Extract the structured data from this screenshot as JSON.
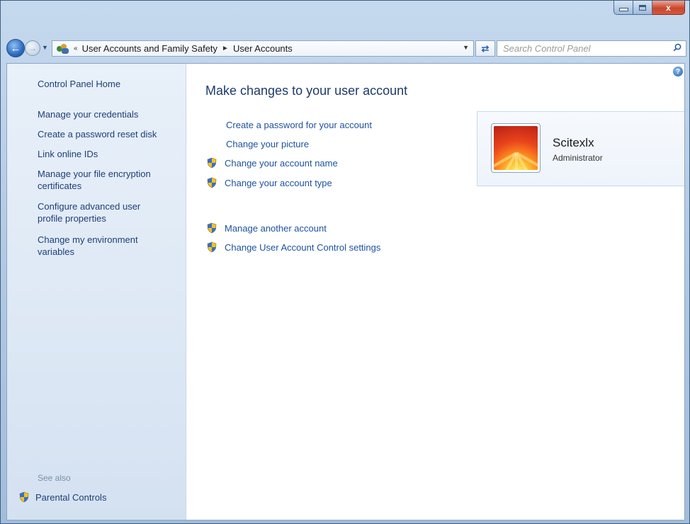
{
  "window": {
    "minimize_label": "minimize",
    "maximize_label": "maximize",
    "close_label": "x"
  },
  "nav": {
    "breadcrumb": {
      "overflow": "«",
      "items": [
        "User Accounts and Family Safety",
        "User Accounts"
      ],
      "separator": "►"
    },
    "search_placeholder": "Search Control Panel"
  },
  "left_pane": {
    "home": "Control Panel Home",
    "links": [
      "Manage your credentials",
      "Create a password reset disk",
      "Link online IDs",
      "Manage your file encryption certificates",
      "Configure advanced user profile properties",
      "Change my environment variables"
    ],
    "see_also_label": "See also",
    "see_also_links": [
      "Parental Controls"
    ]
  },
  "main": {
    "title": "Make changes to your user account",
    "tasks": [
      {
        "label": "Create a password for your account",
        "icon": "none"
      },
      {
        "label": "Change your picture",
        "icon": "none"
      },
      {
        "label": "Change your account name",
        "icon": "uac-shield-icon"
      },
      {
        "label": "Change your account type",
        "icon": "uac-shield-icon"
      }
    ],
    "tasks2": [
      {
        "label": "Manage another account",
        "icon": "uac-shield-icon"
      },
      {
        "label": "Change User Account Control settings",
        "icon": "uac-shield-icon"
      }
    ]
  },
  "account": {
    "name": "Scitexlx",
    "type": "Administrator",
    "picture": "flower-picture"
  },
  "colors": {
    "link": "#1e52a0",
    "left_pane_link": "#1e3f77",
    "title": "#1d3a6b",
    "see_also": "#7d8fa6"
  }
}
